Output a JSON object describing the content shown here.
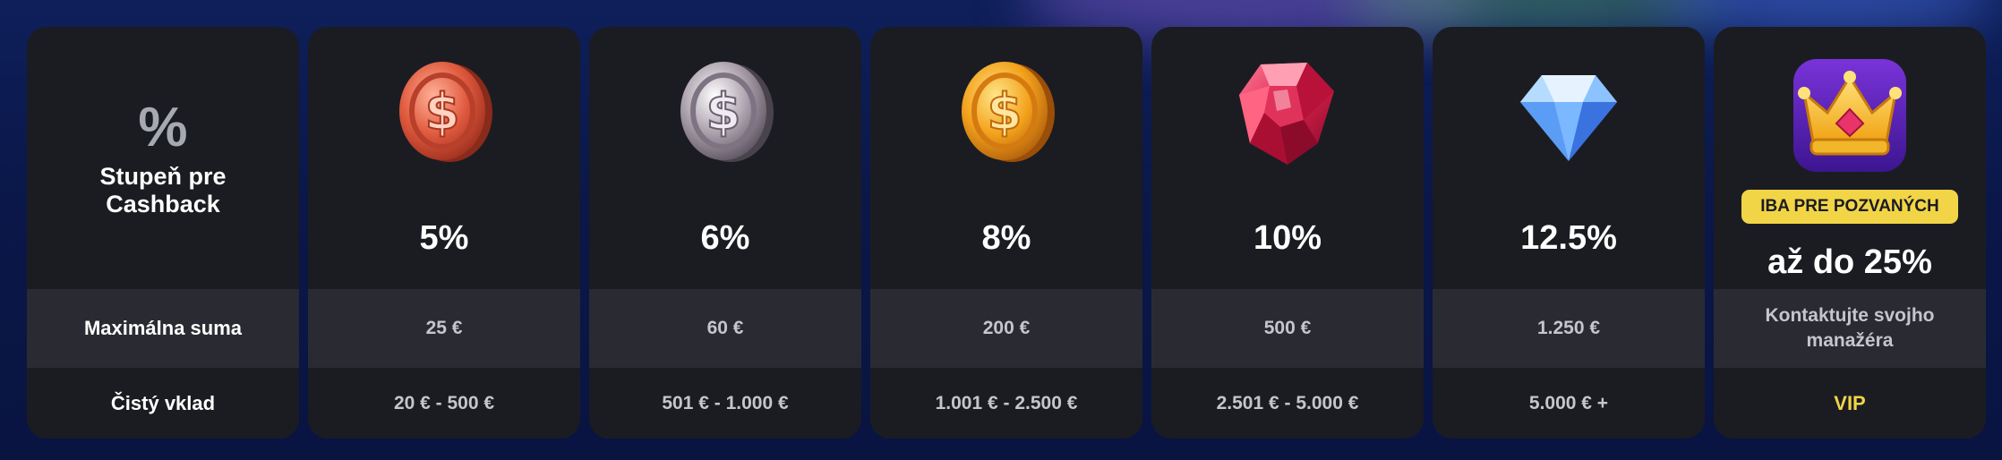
{
  "header": {
    "percent_symbol": "%",
    "tier_title_line1": "Stupeň pre",
    "tier_title_line2": "Cashback"
  },
  "rows": {
    "max_amount_label": "Maximálna suma",
    "net_deposit_label": "Čistý vklad"
  },
  "tiers": [
    {
      "icon": "bronze-coin-icon",
      "percent": "5%",
      "max_amount": "25 €",
      "net_deposit": "20 € - 500 €"
    },
    {
      "icon": "silver-coin-icon",
      "percent": "6%",
      "max_amount": "60 €",
      "net_deposit": "501 € - 1.000 €"
    },
    {
      "icon": "gold-coin-icon",
      "percent": "8%",
      "max_amount": "200 €",
      "net_deposit": "1.001 € - 2.500 €"
    },
    {
      "icon": "ruby-gem-icon",
      "percent": "10%",
      "max_amount": "500 €",
      "net_deposit": "2.501 € - 5.000 €"
    },
    {
      "icon": "diamond-icon",
      "percent": "12.5%",
      "max_amount": "1.250 €",
      "net_deposit": "5.000 € +"
    }
  ],
  "vip": {
    "icon": "crown-icon",
    "badge": "IBA PRE POZVANÝCH",
    "percent": "až do 25%",
    "max_amount_line1": "Kontaktujte svojho",
    "max_amount_line2": "manažéra",
    "net_deposit": "VIP"
  },
  "colors": {
    "card_bg": "#1b1c22",
    "row_bg": "#2a2b32",
    "accent_yellow": "#f2d547",
    "page_bg": "#0a1748"
  }
}
